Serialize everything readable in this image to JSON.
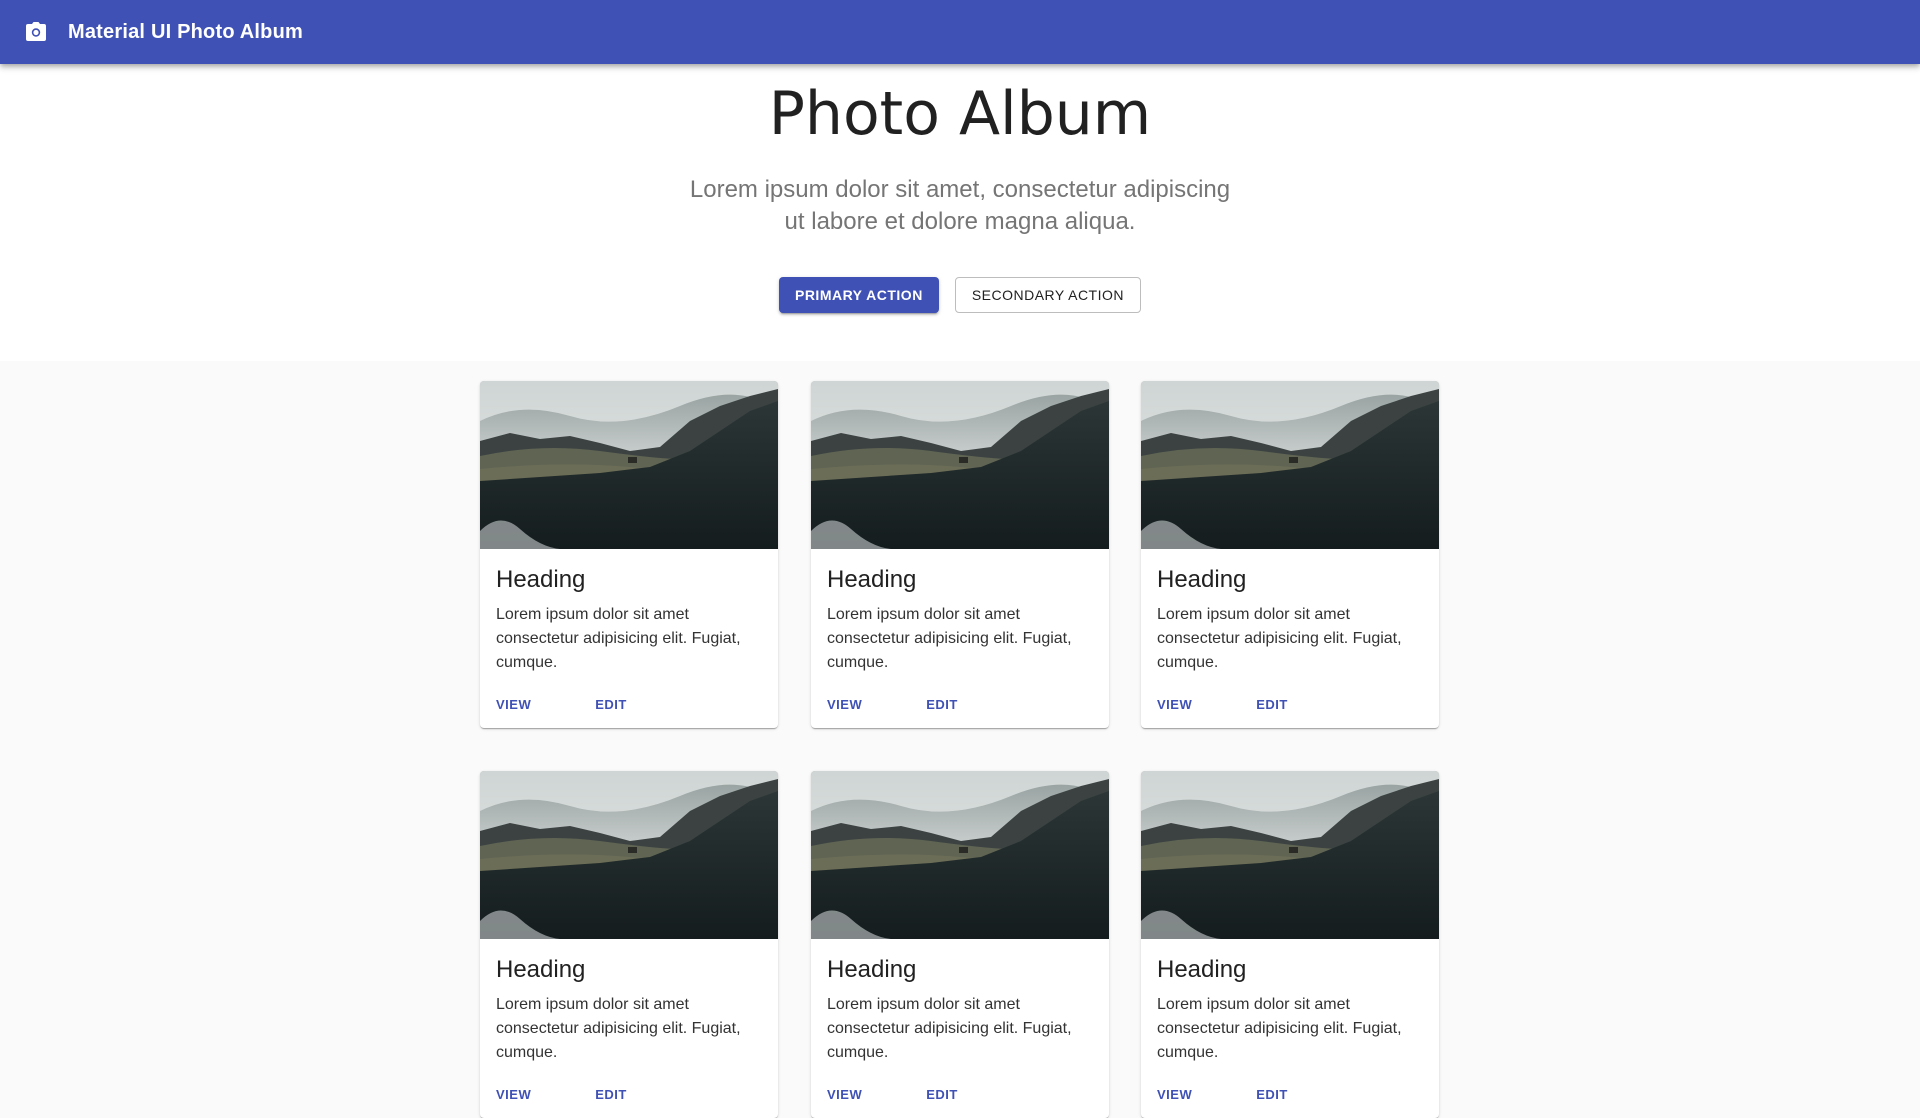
{
  "appbar": {
    "icon": "camera-icon",
    "title": "Material UI Photo Album",
    "color": "#3f51b5"
  },
  "hero": {
    "title": "Photo Album",
    "subtitle_line1": "Lorem ipsum dolor sit amet, consectetur adipiscing",
    "subtitle_line2": "ut labore et dolore magna aliqua.",
    "primary_label": "PRIMARY ACTION",
    "secondary_label": "SECONDARY ACTION"
  },
  "cards": [
    {
      "heading": "Heading",
      "text": "Lorem ipsum dolor sit amet consectetur adipisicing elit. Fugiat, cumque.",
      "view_label": "VIEW",
      "edit_label": "EDIT"
    },
    {
      "heading": "Heading",
      "text": "Lorem ipsum dolor sit amet consectetur adipisicing elit. Fugiat, cumque.",
      "view_label": "VIEW",
      "edit_label": "EDIT"
    },
    {
      "heading": "Heading",
      "text": "Lorem ipsum dolor sit amet consectetur adipisicing elit. Fugiat, cumque.",
      "view_label": "VIEW",
      "edit_label": "EDIT"
    },
    {
      "heading": "Heading",
      "text": "Lorem ipsum dolor sit amet consectetur adipisicing elit. Fugiat, cumque.",
      "view_label": "VIEW",
      "edit_label": "EDIT"
    },
    {
      "heading": "Heading",
      "text": "Lorem ipsum dolor sit amet consectetur adipisicing elit. Fugiat, cumque.",
      "view_label": "VIEW",
      "edit_label": "EDIT"
    },
    {
      "heading": "Heading",
      "text": "Lorem ipsum dolor sit amet consectetur adipisicing elit. Fugiat, cumque.",
      "view_label": "VIEW",
      "edit_label": "EDIT"
    }
  ]
}
